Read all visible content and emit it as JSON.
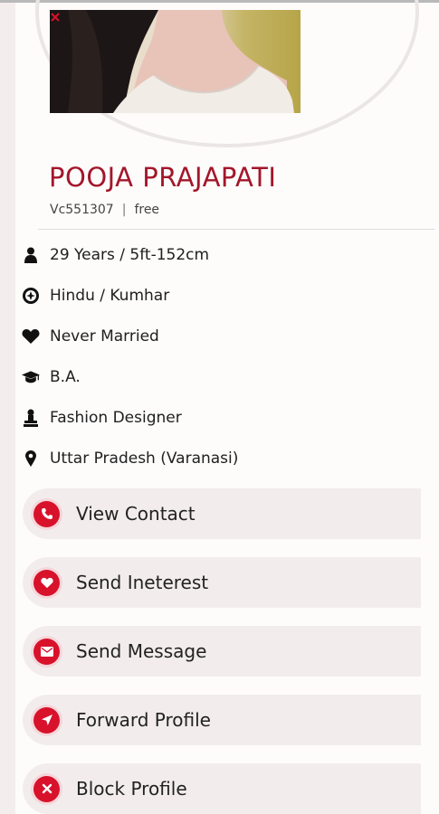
{
  "profile": {
    "name": "POOJA PRAJAPATI",
    "id": "Vc551307",
    "plan": "free",
    "separator": "|"
  },
  "details": [
    {
      "icon": "person-icon",
      "text": "29 Years / 5ft-152cm"
    },
    {
      "icon": "religion-icon",
      "text": "Hindu / Kumhar"
    },
    {
      "icon": "heart-icon",
      "text": "Never Married"
    },
    {
      "icon": "graduation-cap-icon",
      "text": "B.A."
    },
    {
      "icon": "occupation-icon",
      "text": "Fashion Designer"
    },
    {
      "icon": "location-pin-icon",
      "text": "Uttar Pradesh (Varanasi)"
    }
  ],
  "actions": [
    {
      "icon": "phone-icon",
      "label": "View Contact"
    },
    {
      "icon": "heart-icon",
      "label": "Send Ineterest"
    },
    {
      "icon": "envelope-icon",
      "label": "Send Message"
    },
    {
      "icon": "forward-arrow-icon",
      "label": "Forward Profile"
    },
    {
      "icon": "close-icon",
      "label": "Block Profile"
    }
  ],
  "colors": {
    "accent": "#d8122b",
    "name": "#a3162a",
    "action_bg": "#f3eced"
  }
}
